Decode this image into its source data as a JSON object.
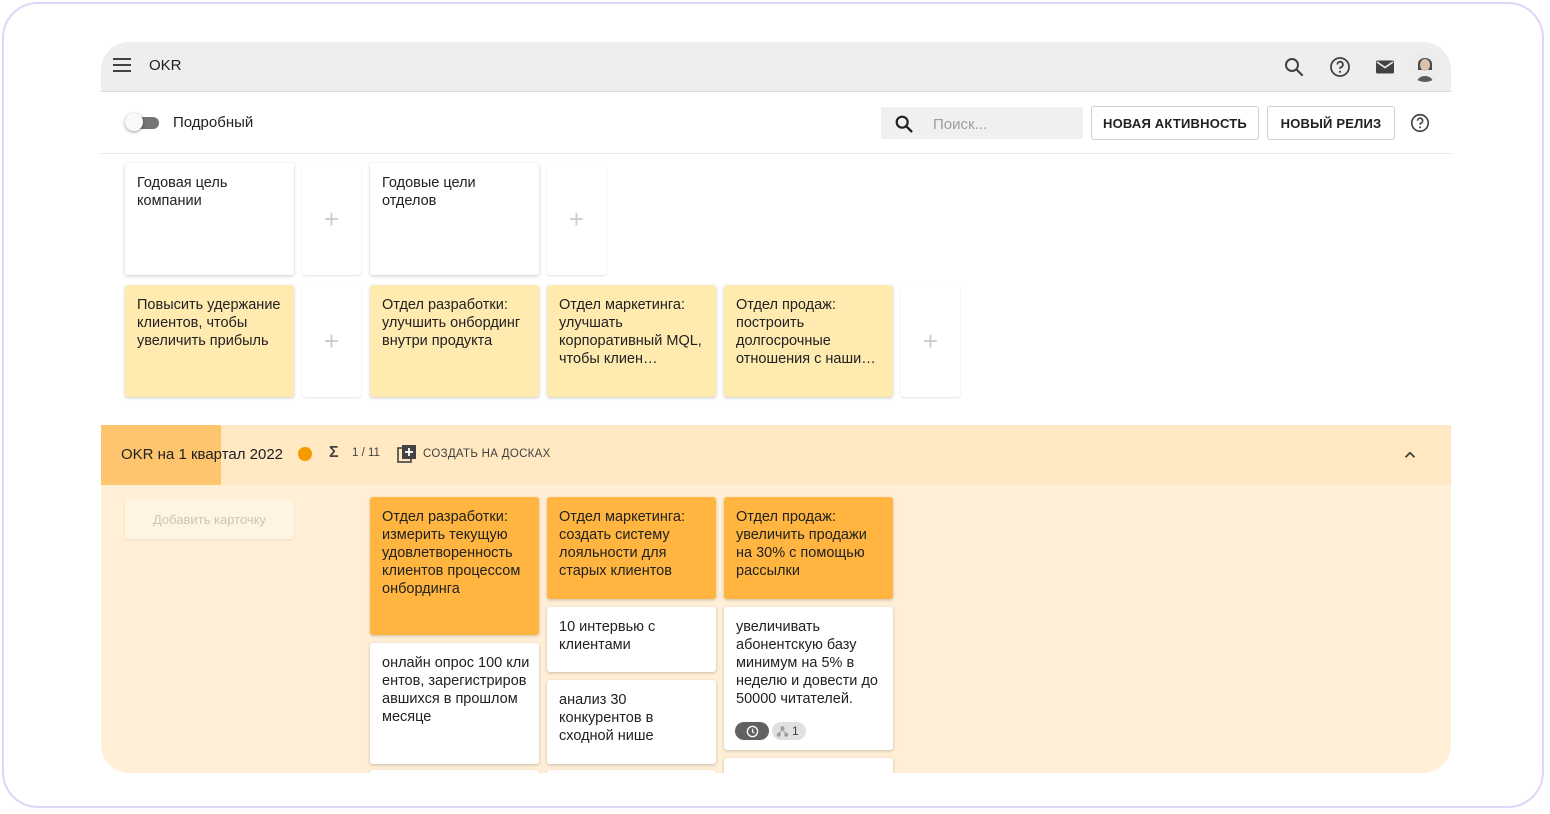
{
  "header": {
    "title": "OKR"
  },
  "toolbar": {
    "toggle_label": "Подробный",
    "search_placeholder": "Поиск...",
    "new_activity_label": "НОВАЯ АКТИВНОСТЬ",
    "new_release_label": "НОВЫЙ РЕЛИЗ"
  },
  "columns": {
    "company_goal": "Годовая цель компании",
    "department_goals": "Годовые цели отделов"
  },
  "goals": {
    "company": "Повысить удержание клиентов, чтобы увеличить прибыль",
    "dev": "Отдел разработки: улучшить онбординг внутри продукта",
    "marketing": "Отдел маркетинга: улучшать корпоративный MQL, чтобы клиен…",
    "sales": "Отдел продаж: построить долгосрочные отношения с наши…"
  },
  "lane": {
    "title": "OKR на 1 квартал 2022",
    "sigma": "Σ",
    "count": "1 / 11",
    "create_label": "СОЗДАТЬ НА ДОСКАХ",
    "add_card_label": "Добавить карточку",
    "colors": {
      "header": "#ffe8c2",
      "accent": "#ffc56e",
      "dot": "#f59b00",
      "body": "#ffefd6"
    }
  },
  "objectives": {
    "dev": "Отдел разработки: измерить текущую удовлетворенность клиентов процессом онбординга",
    "marketing": "Отдел маркетинга: создать систему лояльности для старых клиентов",
    "sales": "Отдел продаж: увеличить продажи на 30% с помощью рассылки"
  },
  "key_results": {
    "dev_1": "онлайн опрос 100 клиентов, зарегистрировавшихся в прошлом месяце",
    "marketing_1": "10 интервью с клиентами",
    "marketing_2": "анализ 30 конкурентов в сходной нише",
    "sales_1": "увеличивать абонентскую базу минимум на 5% в неделю и довести до 50000 читателей.",
    "sales_1_badge_count": "1"
  }
}
